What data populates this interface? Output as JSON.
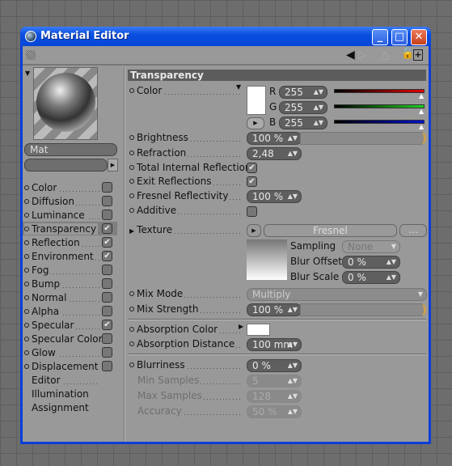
{
  "window": {
    "title": "Material Editor"
  },
  "preview": {
    "material_name": "Mat"
  },
  "channels": [
    {
      "label": "Color",
      "checked": false
    },
    {
      "label": "Diffusion",
      "checked": false
    },
    {
      "label": "Luminance",
      "checked": false
    },
    {
      "label": "Transparency",
      "checked": true,
      "selected": true
    },
    {
      "label": "Reflection",
      "checked": true
    },
    {
      "label": "Environment",
      "checked": true
    },
    {
      "label": "Fog",
      "checked": false
    },
    {
      "label": "Bump",
      "checked": false
    },
    {
      "label": "Normal",
      "checked": false
    },
    {
      "label": "Alpha",
      "checked": false
    },
    {
      "label": "Specular",
      "checked": true
    },
    {
      "label": "Specular Color",
      "checked": false
    },
    {
      "label": "Glow",
      "checked": false
    },
    {
      "label": "Displacement",
      "checked": false
    }
  ],
  "extra_items": [
    "Editor",
    "Illumination",
    "Assignment"
  ],
  "panel": {
    "header": "Transparency",
    "color": {
      "label": "Color",
      "swatch": "#ffffff",
      "r_label": "R",
      "g_label": "G",
      "b_label": "B",
      "r": "255",
      "g": "255",
      "b": "255"
    },
    "brightness": {
      "label": "Brightness",
      "value": "100 %",
      "percent": 100
    },
    "refraction": {
      "label": "Refraction",
      "value": "2,48"
    },
    "tir": {
      "label": "Total Internal Reflection",
      "checked": true
    },
    "exit": {
      "label": "Exit Reflections",
      "checked": true
    },
    "fresnel": {
      "label": "Fresnel Reflectivity",
      "value": "100 %"
    },
    "additive": {
      "label": "Additive",
      "checked": false
    },
    "texture": {
      "label": "Texture",
      "shader": "Fresnel",
      "more": "...",
      "sampling_label": "Sampling",
      "sampling": "None",
      "blur_offset_label": "Blur Offset",
      "blur_offset": "0 %",
      "blur_scale_label": "Blur Scale",
      "blur_scale": "0 %"
    },
    "mix_mode": {
      "label": "Mix Mode",
      "value": "Multiply"
    },
    "mix_strength": {
      "label": "Mix Strength",
      "value": "100 %",
      "percent": 100
    },
    "absorption_color": {
      "label": "Absorption Color",
      "swatch": "#ffffff"
    },
    "absorption_distance": {
      "label": "Absorption Distance",
      "value": "100 mm"
    },
    "blurriness": {
      "label": "Blurriness",
      "value": "0 %"
    },
    "min_samples": {
      "label": "Min Samples",
      "value": "5"
    },
    "max_samples": {
      "label": "Max Samples",
      "value": "128"
    },
    "accuracy": {
      "label": "Accuracy",
      "value": "50 %"
    }
  }
}
